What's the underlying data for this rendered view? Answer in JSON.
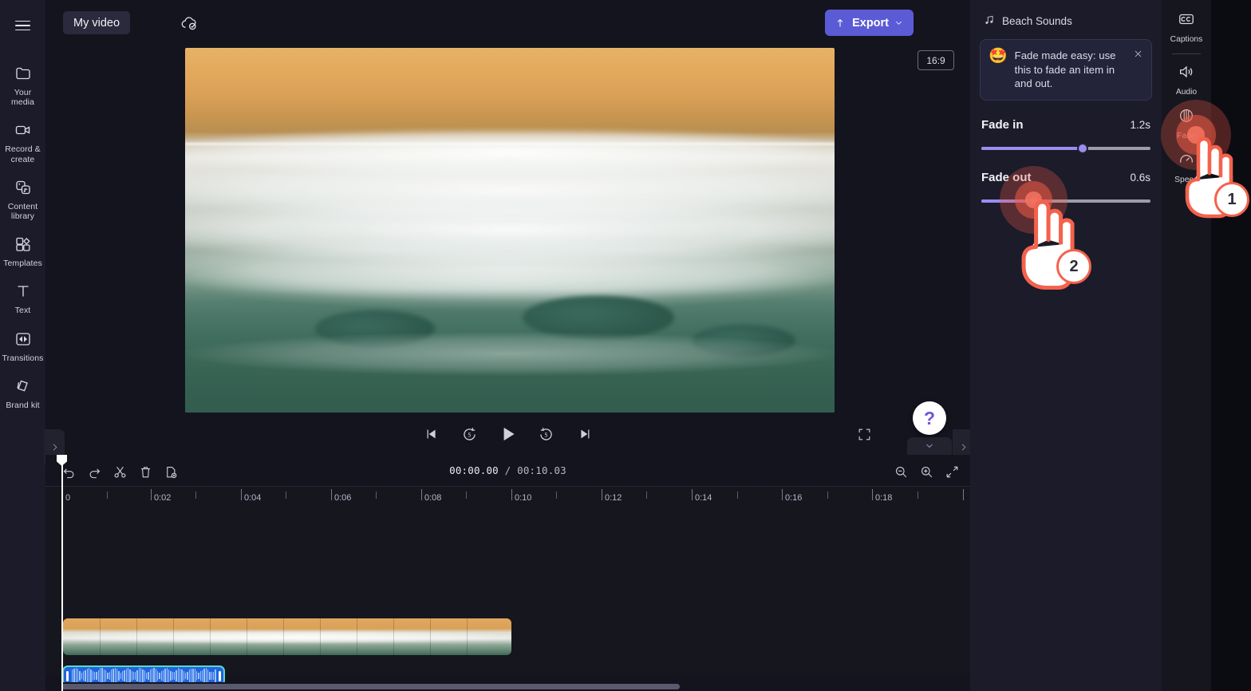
{
  "app": {
    "project_name": "My video",
    "cloud_status_icon": "cloud-saved-icon",
    "menu_icon": "hamburger-menu-icon"
  },
  "left_rail": {
    "items": [
      {
        "label": "Your media",
        "icon": "folder-icon"
      },
      {
        "label": "Record & create",
        "icon": "video-camera-icon"
      },
      {
        "label": "Content library",
        "icon": "content-library-icon"
      },
      {
        "label": "Templates",
        "icon": "templates-icon"
      },
      {
        "label": "Text",
        "icon": "text-icon"
      },
      {
        "label": "Transitions",
        "icon": "transitions-icon"
      },
      {
        "label": "Brand kit",
        "icon": "brand-kit-icon"
      }
    ]
  },
  "toolbar": {
    "export_label": "Export",
    "export_icon": "upload-icon",
    "export_chevron_icon": "chevron-down-icon",
    "export_color": "#5b5bd6"
  },
  "preview": {
    "aspect_ratio": "16:9",
    "help_label": "?",
    "controls": [
      {
        "name": "skip-to-start",
        "icon": "skip-back-icon"
      },
      {
        "name": "rewind-5s",
        "icon": "rewind-5-icon"
      },
      {
        "name": "play",
        "icon": "play-icon"
      },
      {
        "name": "forward-5s",
        "icon": "forward-5-icon"
      },
      {
        "name": "skip-to-end",
        "icon": "skip-forward-icon"
      }
    ],
    "fullscreen_icon": "fullscreen-icon"
  },
  "timeline": {
    "tools": [
      {
        "name": "undo",
        "icon": "undo-icon"
      },
      {
        "name": "redo",
        "icon": "redo-icon"
      },
      {
        "name": "split",
        "icon": "scissors-icon"
      },
      {
        "name": "delete",
        "icon": "trash-icon"
      },
      {
        "name": "duplicate",
        "icon": "duplicate-icon"
      }
    ],
    "current_time": "00:00.00",
    "total_time": "/ 00:10.03",
    "zoom_out_icon": "zoom-out-icon",
    "zoom_in_icon": "zoom-in-icon",
    "fit_icon": "fit-to-screen-icon",
    "ruler_labels": [
      "0",
      "0:02",
      "0:04",
      "0:06",
      "0:08",
      "0:10",
      "0:12",
      "0:14",
      "0:16",
      "0:18"
    ],
    "video_clip_name": "beach-video-clip",
    "audio_clip_name": "beach-sounds-audio-clip"
  },
  "properties": {
    "header_title": "Beach Sounds",
    "header_icon": "music-note-icon",
    "tip": {
      "emoji": "🤩",
      "text": "Fade made easy: use this to fade an item in and out.",
      "close_icon": "close-icon"
    },
    "fade_in": {
      "label": "Fade in",
      "value": "1.2s",
      "percent": 60
    },
    "fade_out": {
      "label": "Fade out",
      "value": "0.6s",
      "percent": 31
    },
    "slider_fill_color": "#9b8cf0",
    "slider_track_color": "#9c9cab"
  },
  "right_rail": {
    "items": [
      {
        "label": "Captions",
        "icon": "closed-captions-icon"
      },
      {
        "label": "Audio",
        "icon": "speaker-icon"
      },
      {
        "label": "Fade",
        "icon": "fade-icon"
      },
      {
        "label": "Speed",
        "icon": "speed-icon"
      }
    ]
  },
  "annotations": {
    "accent_color": "#f4624c",
    "step_one": "1",
    "step_two": "2"
  }
}
